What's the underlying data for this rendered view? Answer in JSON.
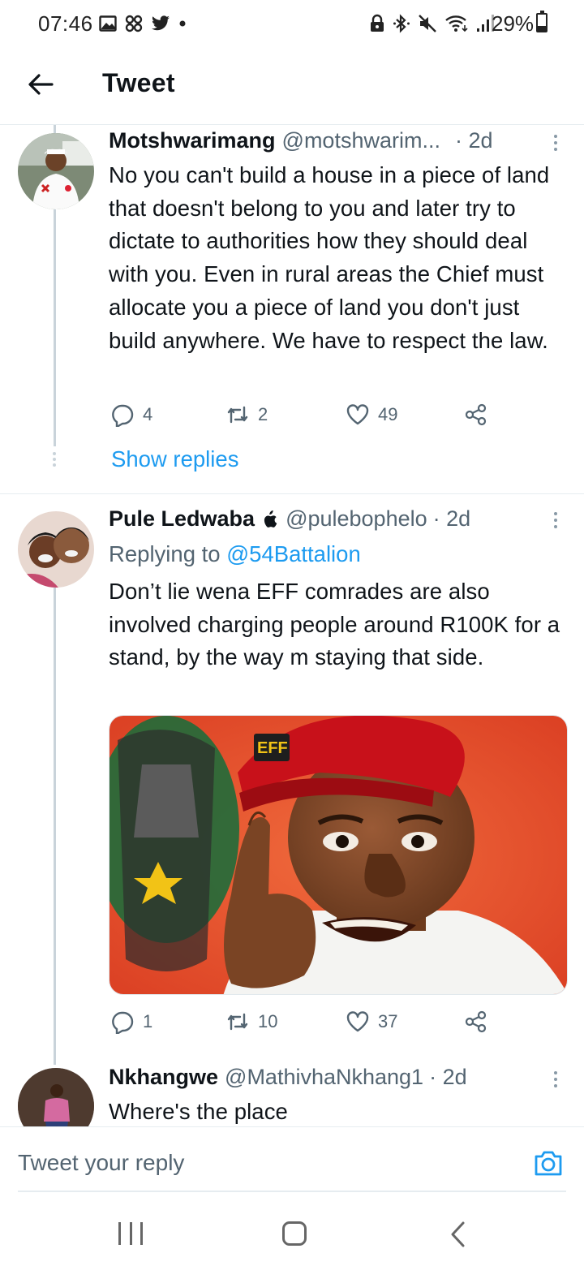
{
  "status_bar": {
    "time": "07:46",
    "battery": "29%",
    "battery_level": 0.29,
    "left_icons": [
      "gallery-icon",
      "pinwheel-icon",
      "twitter-bird-icon",
      "dot-icon"
    ],
    "right_icons": [
      "lock-icon",
      "bluetooth-icon",
      "mute-icon",
      "wifi-icon",
      "signal-icon"
    ]
  },
  "header": {
    "title": "Tweet",
    "back_icon": "arrow-left-icon"
  },
  "tweets": [
    {
      "name": "Motshwarimang",
      "handle": "@motshwarim...",
      "time": "· 2d",
      "text": "No you can't build a house in a piece of land that doesn't belong to you and later try to dictate to authorities how they should deal with you. Even in rural areas the Chief must allocate you a piece of land you don't just build anywhere. We have to respect the law.",
      "replies": "4",
      "retweets": "2",
      "likes": "49",
      "show_replies": "Show replies"
    },
    {
      "name": "Pule Ledwaba",
      "name_badge": "",
      "handle": "@pulebophelo",
      "time": "· 2d",
      "replying_prefix": "Replying to ",
      "replying_to": "@54Battalion",
      "text": "Don’t lie wena EFF comrades are also involved charging people around R100K for a stand, by the way m staying that side.",
      "media_badge_text": "EFF",
      "replies": "1",
      "retweets": "10",
      "likes": "37"
    },
    {
      "name": "Nkhangwe",
      "handle": "@MathivhaNkhang1",
      "time": "· 2d",
      "text": "Where's the place"
    }
  ],
  "reply_bar": {
    "placeholder": "Tweet your reply",
    "camera_icon": "camera-icon"
  },
  "nav_bar": {
    "icons": [
      "recent-apps-icon",
      "home-icon",
      "back-chevron-icon"
    ]
  },
  "colors": {
    "link": "#1d9bf0",
    "secondary_text": "#536471",
    "primary_text": "#0f1419",
    "divider": "#e6ecf0"
  }
}
